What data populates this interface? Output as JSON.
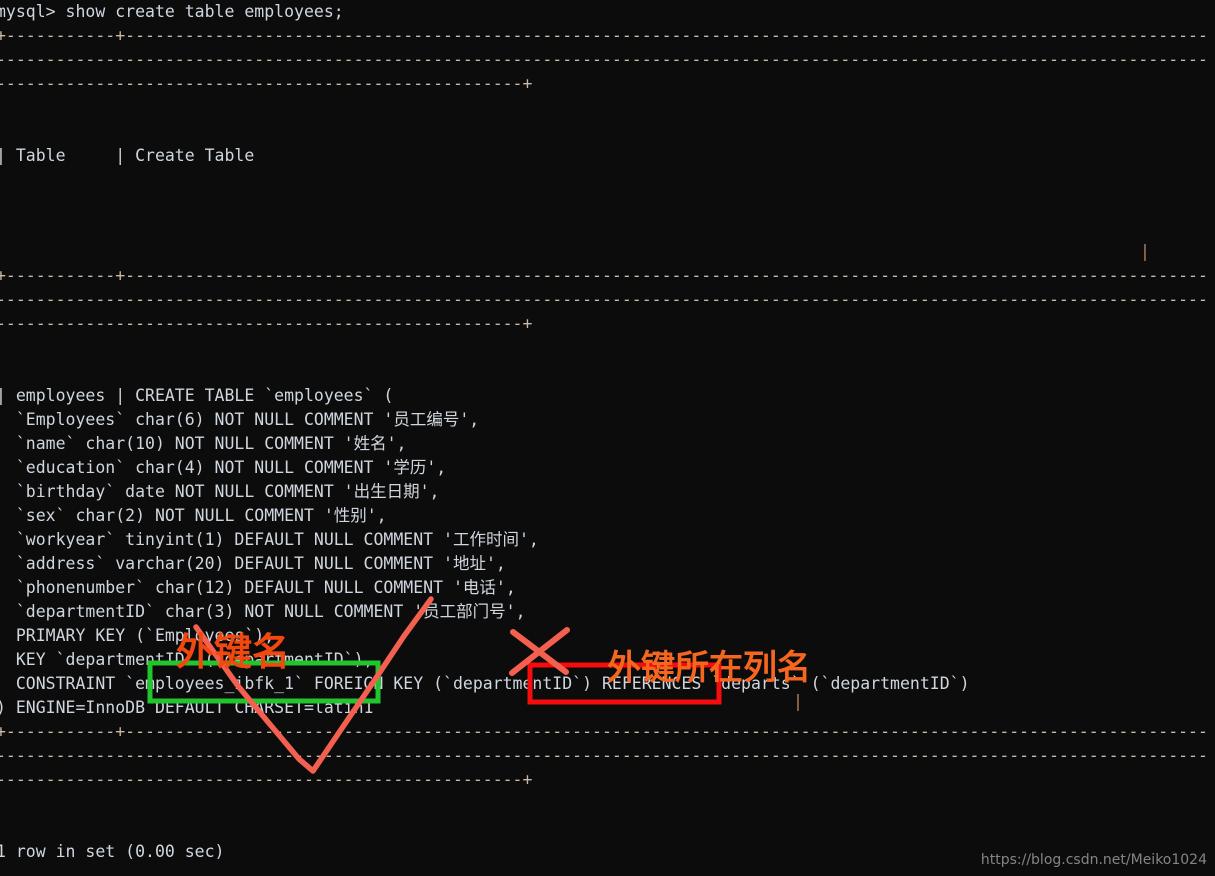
{
  "terminal": {
    "prompt_line": "mysql> show create table employees;",
    "header_row": "| Table     | Create Table",
    "rule_segment_a": "+-----------+",
    "rule_dashes": "----------------------------------------------------------------------------------------------------------------------------------",
    "rule_end_plus": "+",
    "pipe": "|",
    "result_row_label": "| employees | CREATE TABLE `employees` (",
    "sql_lines": [
      "  `Employees` char(6) NOT NULL COMMENT '员工编号',",
      "  `name` char(10) NOT NULL COMMENT '姓名',",
      "  `education` char(4) NOT NULL COMMENT '学历',",
      "  `birthday` date NOT NULL COMMENT '出生日期',",
      "  `sex` char(2) NOT NULL COMMENT '性别',",
      "  `workyear` tinyint(1) DEFAULT NULL COMMENT '工作时间',",
      "  `address` varchar(20) DEFAULT NULL COMMENT '地址',",
      "  `phonenumber` char(12) DEFAULT NULL COMMENT '电话',",
      "  `departmentID` char(3) NOT NULL COMMENT '员工部门号',",
      "  PRIMARY KEY (`Employees`),",
      "  KEY `departmentID` (`departmentID`),",
      "  CONSTRAINT `employees_ibfk_1` FOREIGN KEY (`departmentID`) REFERENCES `departs` (`departmentID`)",
      ") ENGINE=InnoDB DEFAULT CHARSET=latin1"
    ],
    "footer_status": "1 row in set (0.00 sec)"
  },
  "annotations": {
    "fk_name_label": "外键名",
    "fk_column_label": "外键所在列名",
    "fk_name_box_color": "#22c52b",
    "fk_column_box_color": "#f60c0c",
    "fk_name_text_color": "#f0480f",
    "fk_column_text_color": "#f5661e",
    "pointer_color": "#f4604f",
    "cross_color": "#f4604f"
  },
  "watermark": {
    "text": "https://blog.csdn.net/Meiko1024"
  },
  "colors": {
    "background": "#0c0c0c",
    "terminal_text": "#cfd6de",
    "rule_text": "#c9b9a6"
  }
}
